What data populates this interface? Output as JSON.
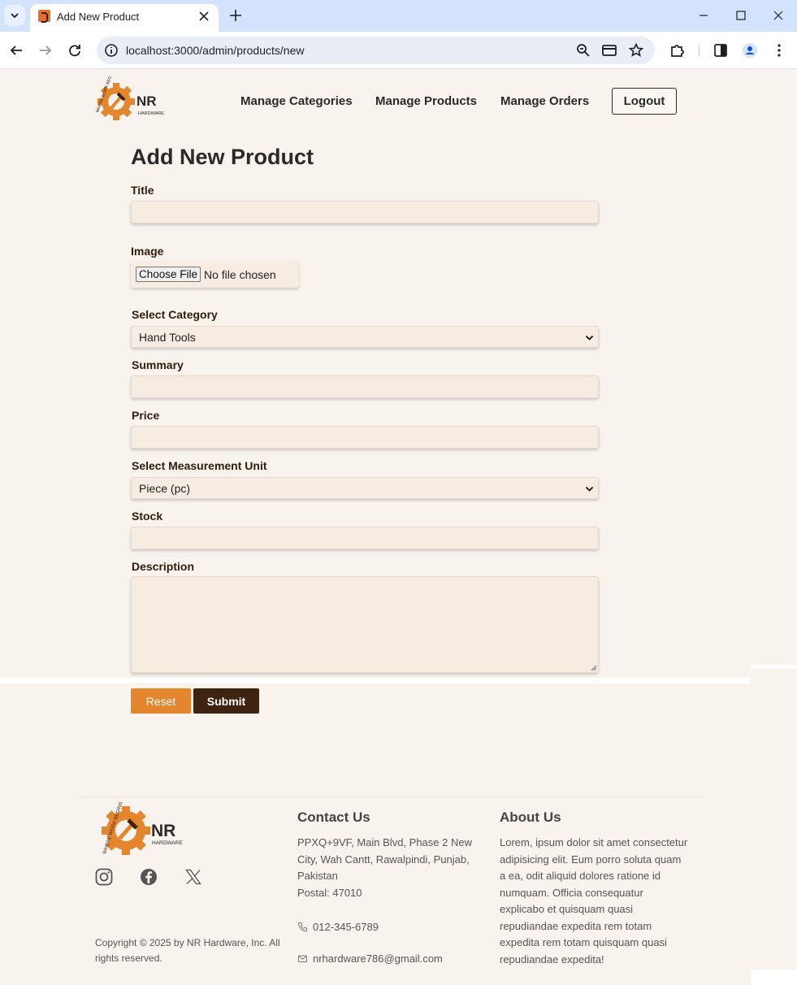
{
  "browser": {
    "tab_title": "Add New Product",
    "url": "localhost:3000/admin/products/new"
  },
  "header": {
    "logo_text": "NR",
    "logo_sub": "HARDWARE",
    "logo_arc": "WHERE WORK BEGINS",
    "nav": [
      "Manage Categories",
      "Manage Products",
      "Manage Orders"
    ],
    "logout_label": "Logout"
  },
  "form": {
    "title": "Add New Product",
    "labels": {
      "title": "Title",
      "image": "Image",
      "category": "Select Category",
      "summary": "Summary",
      "price": "Price",
      "unit": "Select Measurement Unit",
      "stock": "Stock",
      "description": "Description"
    },
    "values": {
      "title": "",
      "summary": "",
      "price": "",
      "stock": "",
      "description": ""
    },
    "file": {
      "button_label": "Choose File",
      "status": "No file chosen"
    },
    "category_selected": "Hand Tools",
    "unit_selected": "Piece (pc)",
    "reset_label": "Reset",
    "submit_label": "Submit"
  },
  "footer": {
    "contact_heading": "Contact Us",
    "address_lines": [
      "PPXQ+9VF, Main Blvd, Phase 2 New",
      "City, Wah Cantt, Rawalpindi, Punjab,",
      "Pakistan",
      "Postal: 47010"
    ],
    "phone": "012-345-6789",
    "email": "nrhardware786@gmail.com",
    "about_heading": "About Us",
    "about_lines": [
      "Lorem, ipsum dolor sit amet consectetur",
      "adipisicing elit. Eum porro soluta quam",
      "a ea, odit aliquid dolores ratione id",
      "numquam. Officia consequatur",
      "explicabo et quisquam quasi",
      "repudiandae expedita rem totam",
      "expedita rem totam quisquam quasi",
      "repudiandae expedita!"
    ],
    "copyright_lines": [
      "Copyright © 2025 by NR Hardware, Inc. All",
      "rights reserved."
    ],
    "social": [
      "instagram-icon",
      "facebook-icon",
      "x-icon"
    ]
  },
  "colors": {
    "accent_orange": "#e4862e",
    "dark_brown": "#3d2310",
    "page_bg": "#f9f3ee",
    "field_bg": "#f7ece1"
  }
}
